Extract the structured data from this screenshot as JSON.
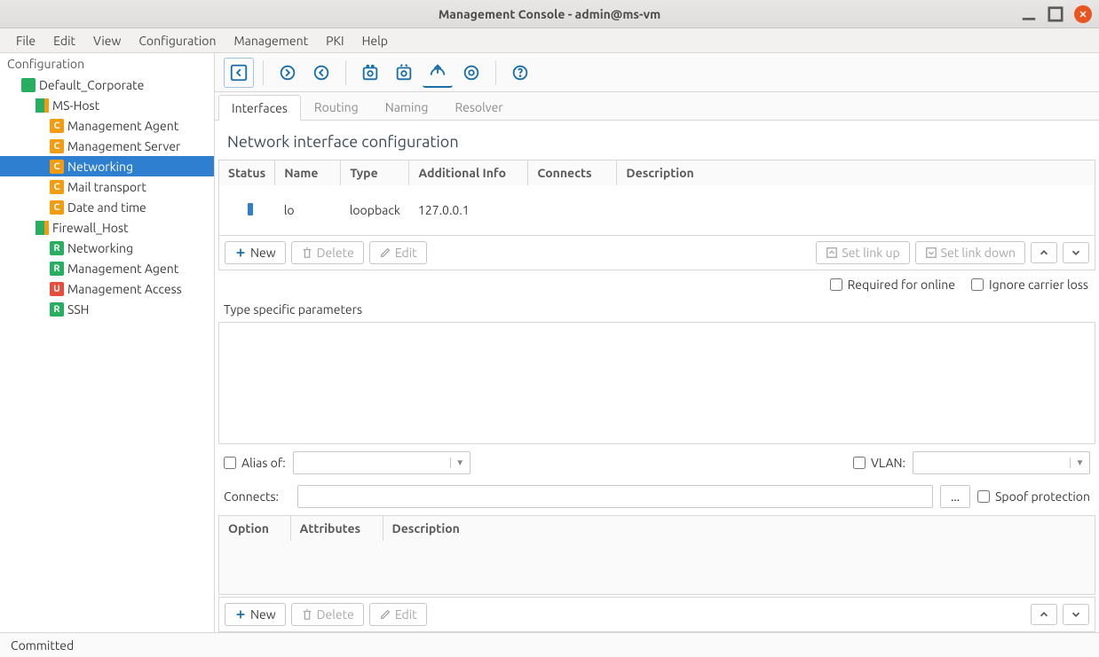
{
  "window": {
    "title": "Management Console - admin@ms-vm"
  },
  "menubar": [
    "File",
    "Edit",
    "View",
    "Configuration",
    "Management",
    "PKI",
    "Help"
  ],
  "sidebar": {
    "header": "Configuration",
    "tree": [
      {
        "label": "Default_Corporate",
        "badge": "green",
        "indent": 1
      },
      {
        "label": "MS-Host",
        "badge": "group",
        "indent": 2
      },
      {
        "label": "Management Agent",
        "badge": "C",
        "indent": 3
      },
      {
        "label": "Management Server",
        "badge": "C",
        "indent": 3
      },
      {
        "label": "Networking",
        "badge": "C",
        "indent": 3,
        "selected": true
      },
      {
        "label": "Mail transport",
        "badge": "C",
        "indent": 3
      },
      {
        "label": "Date and time",
        "badge": "C",
        "indent": 3
      },
      {
        "label": "Firewall_Host",
        "badge": "group",
        "indent": 2
      },
      {
        "label": "Networking",
        "badge": "R",
        "indent": 3
      },
      {
        "label": "Management Agent",
        "badge": "R",
        "indent": 3
      },
      {
        "label": "Management Access",
        "badge": "U",
        "indent": 3
      },
      {
        "label": "SSH",
        "badge": "R",
        "indent": 3
      }
    ]
  },
  "tabs": [
    "Interfaces",
    "Routing",
    "Naming",
    "Resolver"
  ],
  "active_tab": 0,
  "page": {
    "title": "Network interface configuration",
    "iface_cols": [
      "Status",
      "Name",
      "Type",
      "Additional Info",
      "Connects",
      "Description"
    ],
    "iface_rows": [
      {
        "status": "up",
        "name": "lo",
        "type": "loopback",
        "info": "127.0.0.1",
        "connects": "",
        "desc": ""
      }
    ],
    "btns1": {
      "new": "New",
      "delete": "Delete",
      "edit": "Edit",
      "linkup": "Set link up",
      "linkdown": "Set link down"
    },
    "checks": {
      "required": "Required for online",
      "ignore": "Ignore carrier loss"
    },
    "params_label": "Type specific parameters",
    "alias_label": "Alias of:",
    "vlan_label": "VLAN:",
    "connects_label": "Connects:",
    "ellipsis": "...",
    "spoof_label": "Spoof protection",
    "opt_cols": [
      "Option",
      "Attributes",
      "Description"
    ],
    "btns2": {
      "new": "New",
      "delete": "Delete",
      "edit": "Edit"
    }
  },
  "status": "Committed"
}
